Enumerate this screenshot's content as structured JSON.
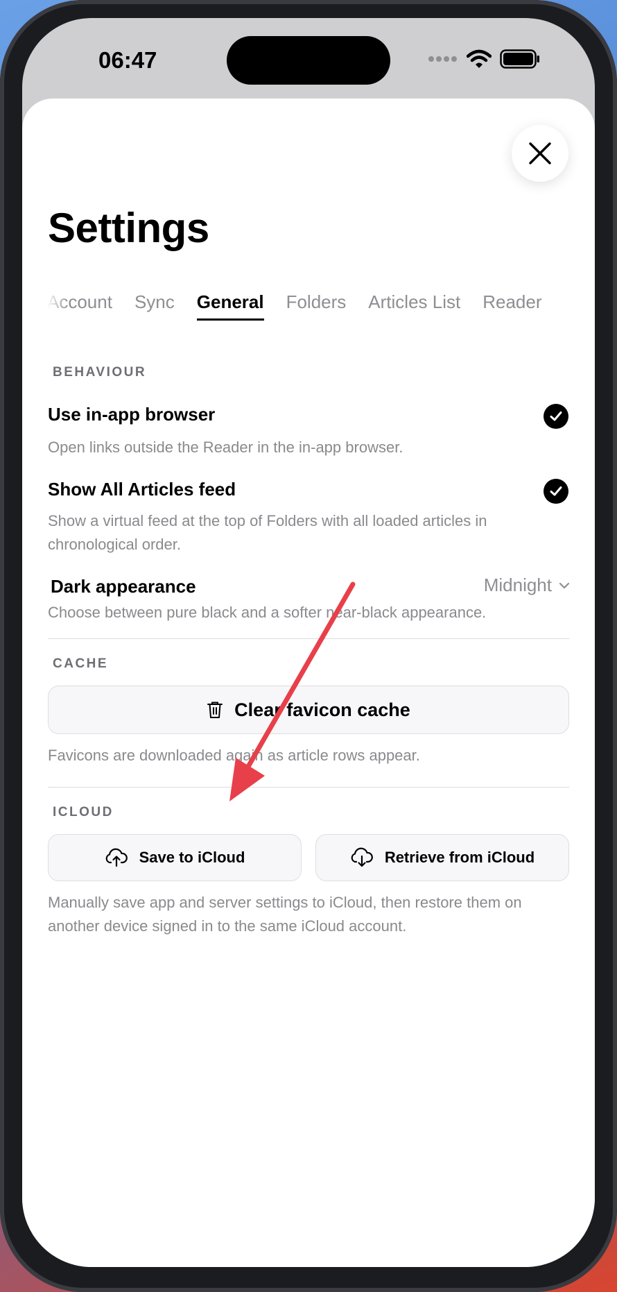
{
  "status_bar": {
    "time": "06:47"
  },
  "settings": {
    "title": "Settings",
    "tabs": [
      {
        "label": "Account",
        "active": false
      },
      {
        "label": "Sync",
        "active": false
      },
      {
        "label": "General",
        "active": true
      },
      {
        "label": "Folders",
        "active": false
      },
      {
        "label": "Articles List",
        "active": false
      },
      {
        "label": "Reader",
        "active": false
      }
    ]
  },
  "behaviour": {
    "header": "BEHAVIOUR",
    "in_app_browser": {
      "title": "Use in-app browser",
      "description": "Open links outside the Reader in the in-app browser.",
      "checked": true
    },
    "all_articles": {
      "title": "Show All Articles feed",
      "description": "Show a virtual feed at the top of Folders with all loaded articles in chronological order.",
      "checked": true
    },
    "dark_appearance": {
      "title": "Dark appearance",
      "value": "Midnight",
      "description": "Choose between pure black and a softer near-black appearance."
    }
  },
  "cache": {
    "header": "CACHE",
    "clear_label": "Clear favicon cache",
    "description": "Favicons are downloaded again as article rows appear."
  },
  "icloud": {
    "header": "ICLOUD",
    "save_label": "Save to iCloud",
    "retrieve_label": "Retrieve from iCloud",
    "description": "Manually save app and server settings to iCloud, then restore them on another device signed in to the same iCloud account."
  },
  "colors": {
    "annotation_arrow": "#e8404a",
    "accent": "#000000",
    "secondary_text": "#8a8a8e"
  }
}
